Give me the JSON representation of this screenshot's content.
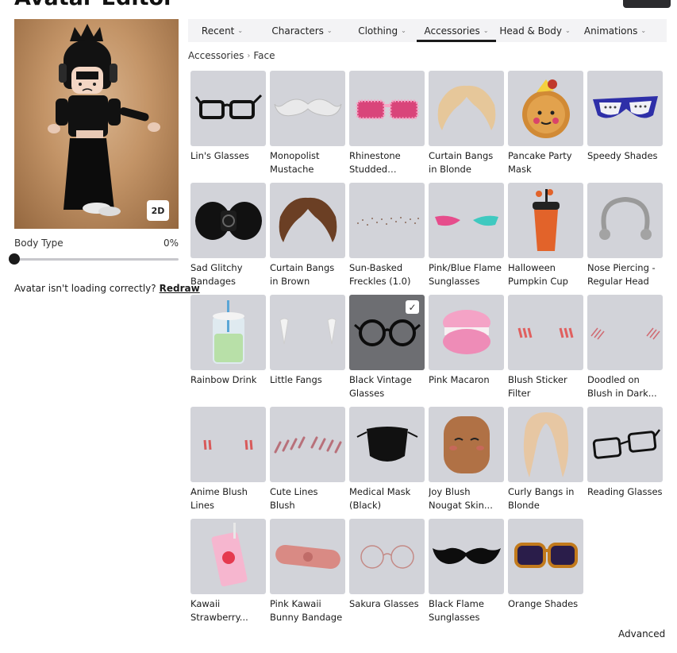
{
  "header": {
    "title": "Avatar Editor"
  },
  "avatar": {
    "view_toggle": "2D",
    "body_type_label": "Body Type",
    "body_type_value": "0%",
    "body_type_level": 0,
    "loading_text": "Avatar isn't loading correctly?",
    "redraw_label": "Redraw"
  },
  "tabs": [
    {
      "label": "Recent"
    },
    {
      "label": "Characters"
    },
    {
      "label": "Clothing"
    },
    {
      "label": "Accessories",
      "active": true
    },
    {
      "label": "Head & Body"
    },
    {
      "label": "Animations"
    }
  ],
  "breadcrumb": {
    "parent": "Accessories",
    "current": "Face"
  },
  "items": [
    {
      "name": "Lin's Glasses",
      "icon": "black-glasses-icon"
    },
    {
      "name": "Monopolist Mustache",
      "icon": "white-mustache-icon"
    },
    {
      "name": "Rhinestone Studded Squar...",
      "icon": "pink-sunglasses-icon"
    },
    {
      "name": "Curtain Bangs in Blonde",
      "icon": "blonde-bangs-icon"
    },
    {
      "name": "Pancake Party Mask",
      "icon": "pancake-mask-icon"
    },
    {
      "name": "Speedy Shades",
      "icon": "purple-shades-icon"
    },
    {
      "name": "Sad Glitchy Bandages",
      "icon": "black-bandages-icon"
    },
    {
      "name": "Curtain Bangs in Brown",
      "icon": "brown-bangs-icon"
    },
    {
      "name": "Sun-Basked Freckles (1.0)",
      "icon": "freckles-icon"
    },
    {
      "name": "Pink/Blue Flame Sunglasses",
      "icon": "flame-sunglasses-icon"
    },
    {
      "name": "Halloween Pumpkin Cup",
      "icon": "pumpkin-cup-icon"
    },
    {
      "name": "Nose Piercing - Regular Head",
      "icon": "nose-ring-icon"
    },
    {
      "name": "Rainbow Drink",
      "icon": "rainbow-drink-icon"
    },
    {
      "name": "Little Fangs",
      "icon": "fangs-icon"
    },
    {
      "name": "Black Vintage Glasses",
      "icon": "vintage-glasses-icon",
      "selected": true
    },
    {
      "name": "Pink Macaron",
      "icon": "macaron-icon"
    },
    {
      "name": "Blush Sticker Filter",
      "icon": "blush-sticker-icon"
    },
    {
      "name": "Doodled on Blush in Dark...",
      "icon": "doodle-blush-icon"
    },
    {
      "name": "Anime Blush Lines",
      "icon": "anime-blush-icon"
    },
    {
      "name": "Cute Lines Blush",
      "icon": "lines-blush-icon"
    },
    {
      "name": "Medical Mask (Black)",
      "icon": "black-mask-icon"
    },
    {
      "name": "Joy Blush Nougat Skin...",
      "icon": "joy-face-icon"
    },
    {
      "name": "Curly Bangs in Blonde",
      "icon": "curly-bangs-icon"
    },
    {
      "name": "Reading Glasses",
      "icon": "reading-glasses-icon"
    },
    {
      "name": "Kawaii Strawberry...",
      "icon": "strawberry-drink-icon"
    },
    {
      "name": "Pink Kawaii Bunny Bandage",
      "icon": "bunny-bandage-icon"
    },
    {
      "name": "Sakura Glasses",
      "icon": "sakura-glasses-icon"
    },
    {
      "name": "Black Flame Sunglasses",
      "icon": "black-flame-sunglasses-icon"
    },
    {
      "name": "Orange Shades",
      "icon": "orange-shades-icon"
    }
  ],
  "footer": {
    "advanced_label": "Advanced"
  },
  "colors": {
    "tile_bg": "#d2d3d9",
    "tile_selected_bg": "#6d6e72",
    "tab_bar_bg": "#f3f3f5",
    "accent": "#1b1b1b"
  }
}
